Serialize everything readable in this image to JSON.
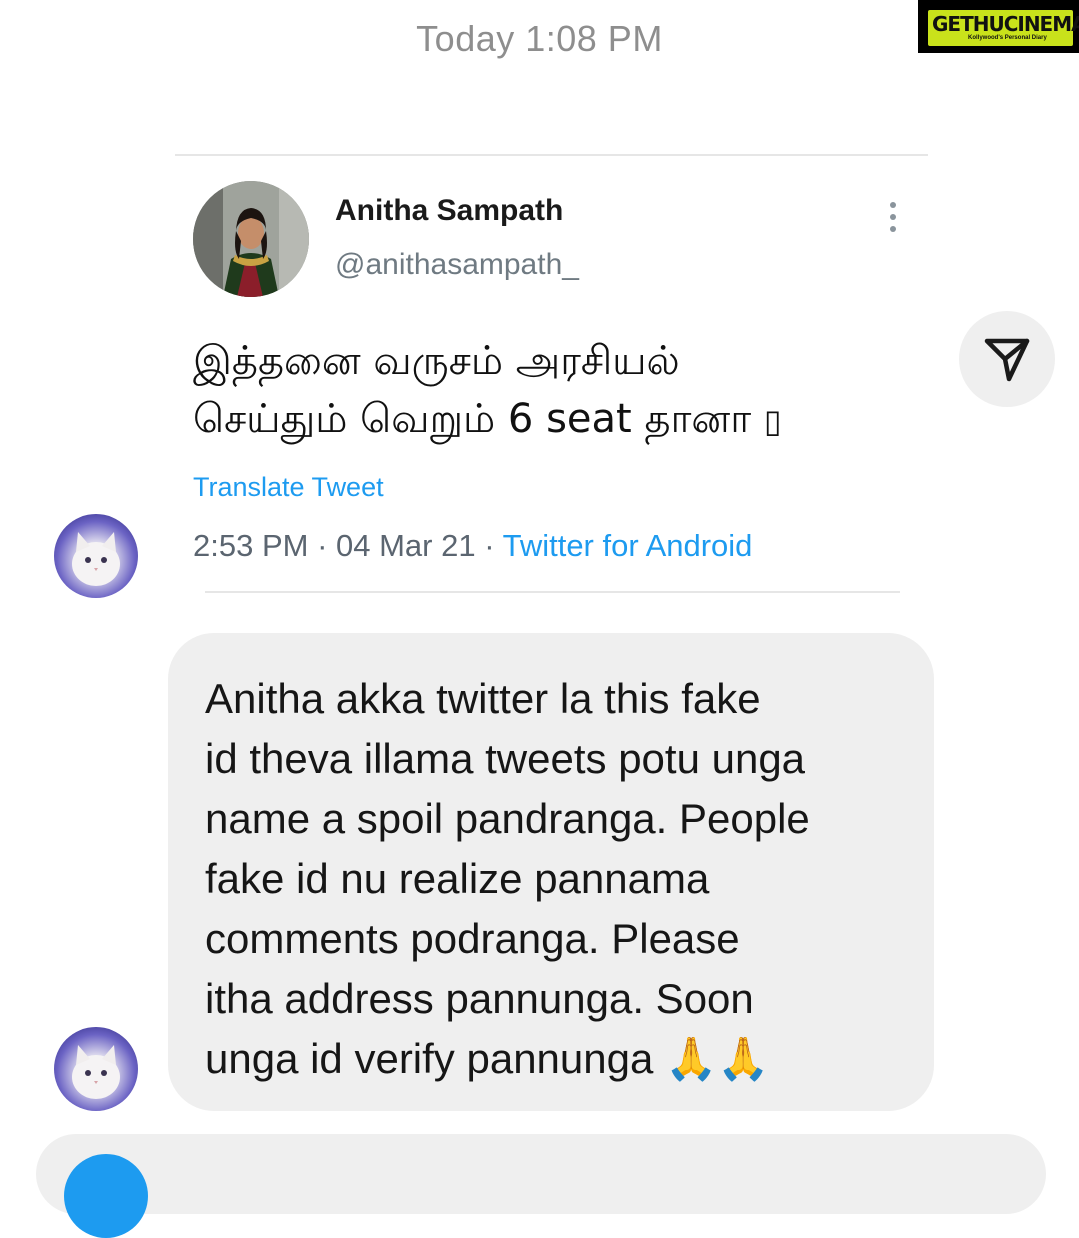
{
  "header": {
    "timestamp": "Today 1:08 PM"
  },
  "watermark": {
    "brand": "GETHUCINEMA",
    "tagline": "Kollywood's Personal Diary"
  },
  "shared_tweet": {
    "author_name": "Anitha Sampath",
    "author_handle": "@anithasampath_",
    "text_line1": "இத்தனை வருசம் அரசியல்",
    "text_line2": "செய்தும் வெறும் 6 seat தானா",
    "emoji_placeholder": "▯",
    "translate_label": "Translate Tweet",
    "time": "2:53 PM",
    "separator": " · ",
    "date": "04 Mar 21",
    "source": "Twitter for Android",
    "more_icon": "more-vertical-icon"
  },
  "share": {
    "icon": "send-arrow-icon"
  },
  "message": {
    "lines": [
      "Anitha akka twitter la this fake",
      "id theva illama tweets potu unga",
      "name a spoil pandranga. People",
      "fake id nu realize pannama",
      "comments podranga. Please",
      "itha address pannunga. Soon",
      "unga id verify pannunga"
    ],
    "emoji": "🙏🙏"
  },
  "colors": {
    "link": "#1d9bf0",
    "bubble": "#efefef",
    "timestamp": "#8e8e8e",
    "watermark_accent": "#c9e21b"
  }
}
